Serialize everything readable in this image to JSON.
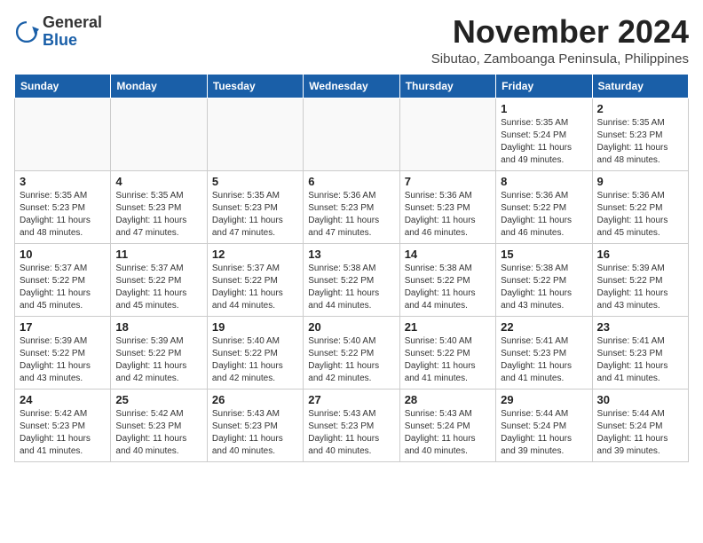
{
  "logo": {
    "general": "General",
    "blue": "Blue"
  },
  "header": {
    "month_year": "November 2024",
    "location": "Sibutao, Zamboanga Peninsula, Philippines"
  },
  "weekdays": [
    "Sunday",
    "Monday",
    "Tuesday",
    "Wednesday",
    "Thursday",
    "Friday",
    "Saturday"
  ],
  "weeks": [
    [
      {
        "day": "",
        "info": ""
      },
      {
        "day": "",
        "info": ""
      },
      {
        "day": "",
        "info": ""
      },
      {
        "day": "",
        "info": ""
      },
      {
        "day": "",
        "info": ""
      },
      {
        "day": "1",
        "info": "Sunrise: 5:35 AM\nSunset: 5:24 PM\nDaylight: 11 hours and 49 minutes."
      },
      {
        "day": "2",
        "info": "Sunrise: 5:35 AM\nSunset: 5:23 PM\nDaylight: 11 hours and 48 minutes."
      }
    ],
    [
      {
        "day": "3",
        "info": "Sunrise: 5:35 AM\nSunset: 5:23 PM\nDaylight: 11 hours and 48 minutes."
      },
      {
        "day": "4",
        "info": "Sunrise: 5:35 AM\nSunset: 5:23 PM\nDaylight: 11 hours and 47 minutes."
      },
      {
        "day": "5",
        "info": "Sunrise: 5:35 AM\nSunset: 5:23 PM\nDaylight: 11 hours and 47 minutes."
      },
      {
        "day": "6",
        "info": "Sunrise: 5:36 AM\nSunset: 5:23 PM\nDaylight: 11 hours and 47 minutes."
      },
      {
        "day": "7",
        "info": "Sunrise: 5:36 AM\nSunset: 5:23 PM\nDaylight: 11 hours and 46 minutes."
      },
      {
        "day": "8",
        "info": "Sunrise: 5:36 AM\nSunset: 5:22 PM\nDaylight: 11 hours and 46 minutes."
      },
      {
        "day": "9",
        "info": "Sunrise: 5:36 AM\nSunset: 5:22 PM\nDaylight: 11 hours and 45 minutes."
      }
    ],
    [
      {
        "day": "10",
        "info": "Sunrise: 5:37 AM\nSunset: 5:22 PM\nDaylight: 11 hours and 45 minutes."
      },
      {
        "day": "11",
        "info": "Sunrise: 5:37 AM\nSunset: 5:22 PM\nDaylight: 11 hours and 45 minutes."
      },
      {
        "day": "12",
        "info": "Sunrise: 5:37 AM\nSunset: 5:22 PM\nDaylight: 11 hours and 44 minutes."
      },
      {
        "day": "13",
        "info": "Sunrise: 5:38 AM\nSunset: 5:22 PM\nDaylight: 11 hours and 44 minutes."
      },
      {
        "day": "14",
        "info": "Sunrise: 5:38 AM\nSunset: 5:22 PM\nDaylight: 11 hours and 44 minutes."
      },
      {
        "day": "15",
        "info": "Sunrise: 5:38 AM\nSunset: 5:22 PM\nDaylight: 11 hours and 43 minutes."
      },
      {
        "day": "16",
        "info": "Sunrise: 5:39 AM\nSunset: 5:22 PM\nDaylight: 11 hours and 43 minutes."
      }
    ],
    [
      {
        "day": "17",
        "info": "Sunrise: 5:39 AM\nSunset: 5:22 PM\nDaylight: 11 hours and 43 minutes."
      },
      {
        "day": "18",
        "info": "Sunrise: 5:39 AM\nSunset: 5:22 PM\nDaylight: 11 hours and 42 minutes."
      },
      {
        "day": "19",
        "info": "Sunrise: 5:40 AM\nSunset: 5:22 PM\nDaylight: 11 hours and 42 minutes."
      },
      {
        "day": "20",
        "info": "Sunrise: 5:40 AM\nSunset: 5:22 PM\nDaylight: 11 hours and 42 minutes."
      },
      {
        "day": "21",
        "info": "Sunrise: 5:40 AM\nSunset: 5:22 PM\nDaylight: 11 hours and 41 minutes."
      },
      {
        "day": "22",
        "info": "Sunrise: 5:41 AM\nSunset: 5:23 PM\nDaylight: 11 hours and 41 minutes."
      },
      {
        "day": "23",
        "info": "Sunrise: 5:41 AM\nSunset: 5:23 PM\nDaylight: 11 hours and 41 minutes."
      }
    ],
    [
      {
        "day": "24",
        "info": "Sunrise: 5:42 AM\nSunset: 5:23 PM\nDaylight: 11 hours and 41 minutes."
      },
      {
        "day": "25",
        "info": "Sunrise: 5:42 AM\nSunset: 5:23 PM\nDaylight: 11 hours and 40 minutes."
      },
      {
        "day": "26",
        "info": "Sunrise: 5:43 AM\nSunset: 5:23 PM\nDaylight: 11 hours and 40 minutes."
      },
      {
        "day": "27",
        "info": "Sunrise: 5:43 AM\nSunset: 5:23 PM\nDaylight: 11 hours and 40 minutes."
      },
      {
        "day": "28",
        "info": "Sunrise: 5:43 AM\nSunset: 5:24 PM\nDaylight: 11 hours and 40 minutes."
      },
      {
        "day": "29",
        "info": "Sunrise: 5:44 AM\nSunset: 5:24 PM\nDaylight: 11 hours and 39 minutes."
      },
      {
        "day": "30",
        "info": "Sunrise: 5:44 AM\nSunset: 5:24 PM\nDaylight: 11 hours and 39 minutes."
      }
    ]
  ]
}
